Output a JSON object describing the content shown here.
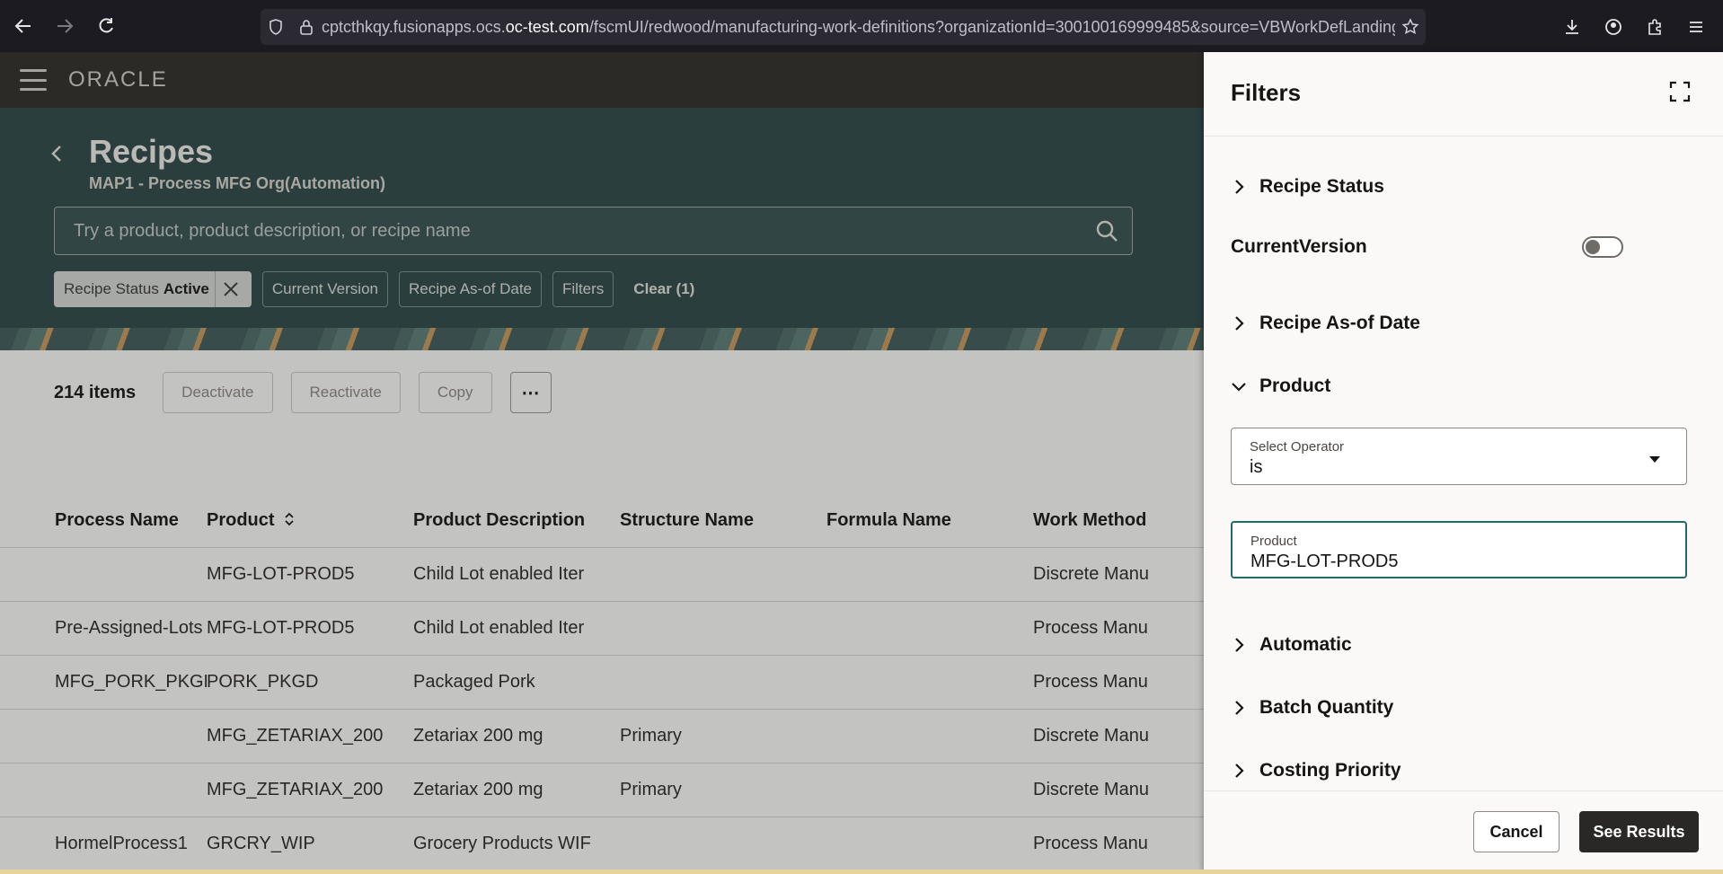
{
  "browser": {
    "url_prefix": "cptcthkqy.fusionapps.ocs.",
    "url_domain": "oc-test.com",
    "url_rest": "/fscmUI/redwood/manufacturing-work-definitions?organizationId=300100169999485&source=VBWorkDefLanding&a"
  },
  "app": {
    "logo": "ORACLE"
  },
  "page": {
    "title": "Recipes",
    "subtitle": "MAP1 - Process MFG Org(Automation)",
    "search_placeholder": "Try a product, product description, or recipe name"
  },
  "chips": {
    "status_label": "Recipe Status",
    "status_value": "Active",
    "current_version": "Current Version",
    "as_of_date": "Recipe As-of Date",
    "filters": "Filters",
    "clear": "Clear (1)"
  },
  "toolbar": {
    "count": "214 items",
    "deactivate": "Deactivate",
    "reactivate": "Reactivate",
    "copy": "Copy",
    "more": "⋯"
  },
  "table": {
    "headers": [
      "Process Name",
      "Product",
      "Product Description",
      "Structure Name",
      "Formula Name",
      "Work Method"
    ],
    "rows": [
      [
        "",
        "MFG-LOT-PROD5",
        "Child Lot enabled Iter",
        "",
        "",
        "Discrete Manu"
      ],
      [
        "Pre-Assigned-Lots",
        "MFG-LOT-PROD5",
        "Child Lot enabled Iter",
        "",
        "",
        "Process Manu"
      ],
      [
        "MFG_PORK_PKGD",
        "PORK_PKGD",
        "Packaged Pork",
        "",
        "",
        "Process Manu"
      ],
      [
        "",
        "MFG_ZETARIAX_200",
        "Zetariax 200 mg",
        "Primary",
        "",
        "Discrete Manu"
      ],
      [
        "",
        "MFG_ZETARIAX_200",
        "Zetariax 200 mg",
        "Primary",
        "",
        "Discrete Manu"
      ],
      [
        "HormelProcess1",
        "GRCRY_WIP",
        "Grocery Products WIF",
        "",
        "",
        "Process Manu"
      ]
    ]
  },
  "drawer": {
    "title": "Filters",
    "recipe_status": "Recipe Status",
    "current_version": "CurrentVersion",
    "current_version_on": false,
    "as_of_date": "Recipe As-of Date",
    "product_section": "Product",
    "operator_label": "Select Operator",
    "operator_value": "is",
    "product_label": "Product",
    "product_value": "MFG-LOT-PROD5",
    "automatic": "Automatic",
    "batch_quantity": "Batch Quantity",
    "costing_priority": "Costing Priority",
    "cancel": "Cancel",
    "see_results": "See Results"
  },
  "colors": {
    "band": "#2c4748",
    "header": "#2f2c28",
    "primary_button": "#2a2826",
    "focus": "#236a6c"
  }
}
